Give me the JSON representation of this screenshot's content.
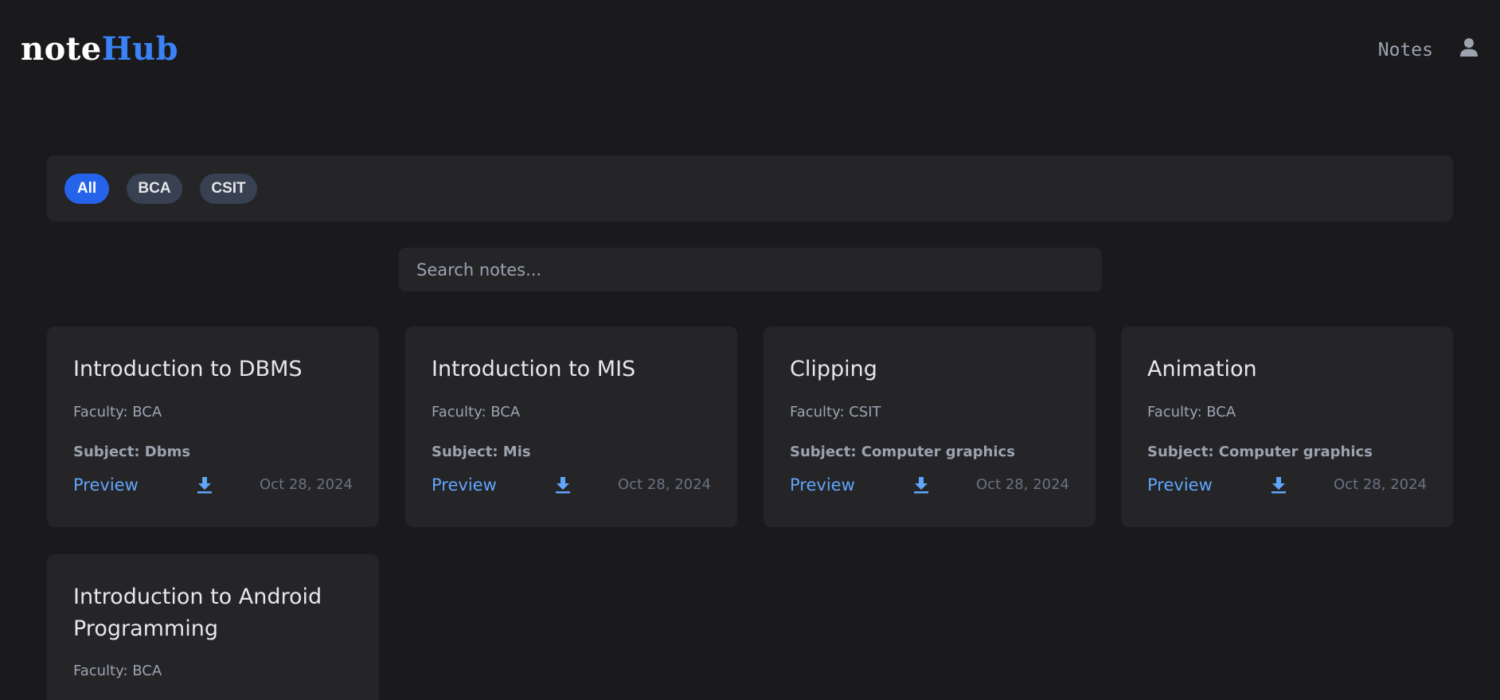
{
  "header": {
    "logo_part1": "note",
    "logo_part2": "Hub",
    "nav_notes": "Notes",
    "user_icon": "user-icon"
  },
  "filters": [
    {
      "label": "All",
      "active": true
    },
    {
      "label": "BCA",
      "active": false
    },
    {
      "label": "CSIT",
      "active": false
    }
  ],
  "search": {
    "placeholder": "Search notes...",
    "value": ""
  },
  "labels": {
    "faculty_prefix": "Faculty: ",
    "subject_prefix": "Subject: ",
    "preview": "Preview"
  },
  "notes": [
    {
      "title": "Introduction to DBMS",
      "faculty": "BCA",
      "subject": "Dbms",
      "date": "Oct 28, 2024"
    },
    {
      "title": "Introduction to MIS",
      "faculty": "BCA",
      "subject": "Mis",
      "date": "Oct 28, 2024"
    },
    {
      "title": "Clipping",
      "faculty": "CSIT",
      "subject": "Computer graphics",
      "date": "Oct 28, 2024"
    },
    {
      "title": "Animation",
      "faculty": "BCA",
      "subject": "Computer graphics",
      "date": "Oct 28, 2024"
    },
    {
      "title": "Introduction to Android Programming",
      "faculty": "BCA",
      "subject": "",
      "date": ""
    }
  ],
  "colors": {
    "accent": "#2563eb",
    "link": "#60a5fa",
    "background": "#1a1a1c",
    "card": "#252528"
  }
}
